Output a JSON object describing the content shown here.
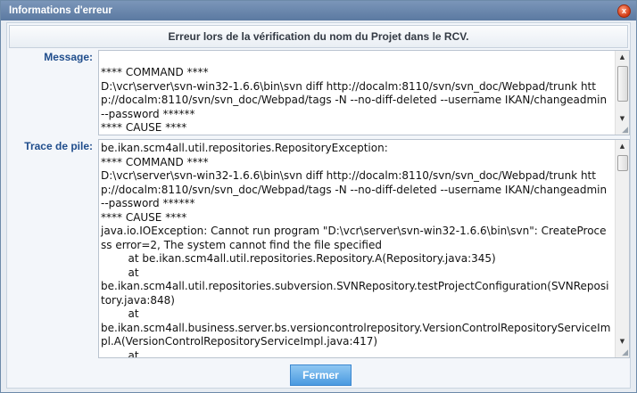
{
  "window": {
    "title": "Informations d'erreur",
    "close_glyph": "x"
  },
  "header": {
    "text": "Erreur lors de la vérification du nom du Projet dans le RCV."
  },
  "message": {
    "label": "Message:",
    "content": "**** COMMAND ****\nD:\\vcr\\server\\svn-win32-1.6.6\\bin\\svn diff http://docalm:8110/svn/svn_doc/Webpad/trunk http://docalm:8110/svn/svn_doc/Webpad/tags -N --no-diff-deleted --username IKAN/changeadmin --password ******\n**** CAUSE ****"
  },
  "stack_trace": {
    "label": "Trace de pile:",
    "content": "be.ikan.scm4all.util.repositories.RepositoryException:\n**** COMMAND ****\nD:\\vcr\\server\\svn-win32-1.6.6\\bin\\svn diff http://docalm:8110/svn/svn_doc/Webpad/trunk http://docalm:8110/svn/svn_doc/Webpad/tags -N --no-diff-deleted --username IKAN/changeadmin --password ******\n**** CAUSE ****\njava.io.IOException: Cannot run program \"D:\\vcr\\server\\svn-win32-1.6.6\\bin\\svn\": CreateProcess error=2, The system cannot find the file specified\n        at be.ikan.scm4all.util.repositories.Repository.A(Repository.java:345)\n        at\nbe.ikan.scm4all.util.repositories.subversion.SVNRepository.testProjectConfiguration(SVNRepository.java:848)\n        at\nbe.ikan.scm4all.business.server.bs.versioncontrolrepository.VersionControlRepositoryServiceImpl.A(VersionControlRepositoryServiceImpl.java:417)\n        at"
  },
  "actions": {
    "close_label": "Fermer"
  },
  "icons": {
    "scroll_up": "▲",
    "scroll_down": "▼",
    "resize_grip": "◢"
  },
  "colors": {
    "title_bar": "#6a86ad",
    "label": "#1f4d8c",
    "button": "#5aa6e6"
  }
}
